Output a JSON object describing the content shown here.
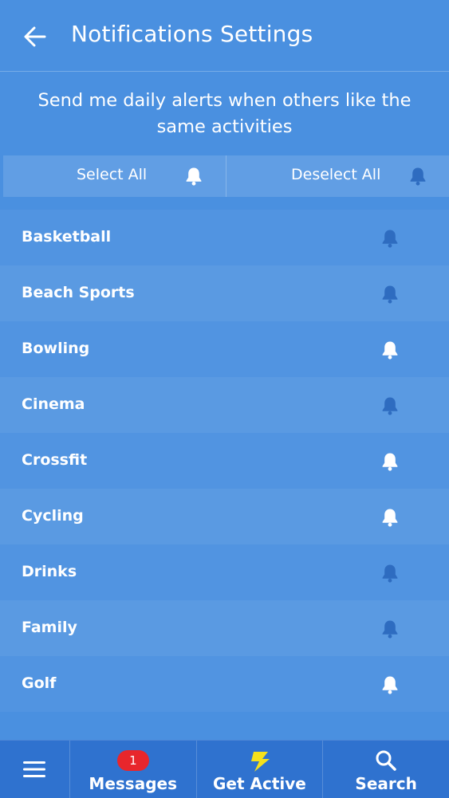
{
  "header": {
    "title": "Notifications Settings",
    "back_icon": "arrow-left-icon"
  },
  "subtitle": "Send me daily alerts when others like the same activities",
  "select_bar": {
    "select_all_label": "Select All",
    "deselect_all_label": "Deselect All"
  },
  "activities": [
    {
      "label": "Basketball",
      "enabled": false
    },
    {
      "label": "Beach Sports",
      "enabled": false
    },
    {
      "label": "Bowling",
      "enabled": true
    },
    {
      "label": "Cinema",
      "enabled": false
    },
    {
      "label": "Crossfit",
      "enabled": true
    },
    {
      "label": "Cycling",
      "enabled": true
    },
    {
      "label": "Drinks",
      "enabled": false
    },
    {
      "label": "Family",
      "enabled": false
    },
    {
      "label": "Golf",
      "enabled": true
    }
  ],
  "tabbar": {
    "messages_label": "Messages",
    "messages_badge": "1",
    "get_active_label": "Get Active",
    "search_label": "Search"
  },
  "colors": {
    "background": "#4a90e0",
    "tabbar": "#2f72cf",
    "bell_on": "#ffffff",
    "bell_off": "#2e6cc0",
    "badge": "#e8262c",
    "bolt": "#f5e11c"
  }
}
